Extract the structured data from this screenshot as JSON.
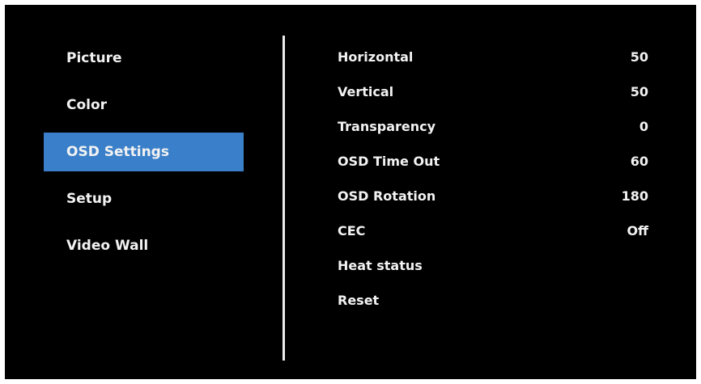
{
  "colors": {
    "background": "#000000",
    "text": "#f2f2f2",
    "selected": "#3a7fc9",
    "divider": "#ededed"
  },
  "menu": {
    "items": [
      {
        "label": "Picture"
      },
      {
        "label": "Color"
      },
      {
        "label": "OSD Settings",
        "selected": true
      },
      {
        "label": "Setup"
      },
      {
        "label": "Video Wall"
      }
    ]
  },
  "settings": {
    "rows": [
      {
        "label": "Horizontal",
        "value": "50"
      },
      {
        "label": "Vertical",
        "value": "50"
      },
      {
        "label": "Transparency",
        "value": "0"
      },
      {
        "label": "OSD Time Out",
        "value": "60"
      },
      {
        "label": "OSD Rotation",
        "value": "180"
      },
      {
        "label": "CEC",
        "value": "Off"
      },
      {
        "label": "Heat status",
        "value": ""
      },
      {
        "label": "Reset",
        "value": ""
      }
    ]
  }
}
